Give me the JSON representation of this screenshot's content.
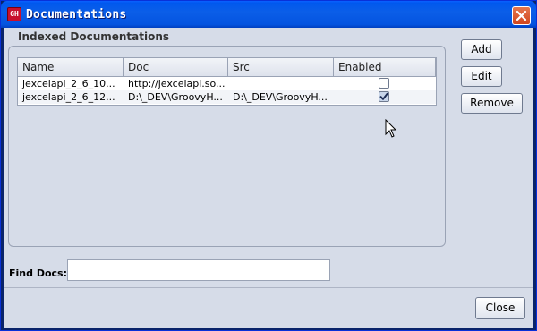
{
  "window": {
    "title": "Documentations",
    "icon_text": "GH"
  },
  "group": {
    "title": "Indexed Documentations"
  },
  "table": {
    "columns": [
      "Name",
      "Doc",
      "Src",
      "Enabled"
    ],
    "rows": [
      {
        "name": "jexcelapi_2_6_10...",
        "doc": "http://jexcelapi.so...",
        "src": "",
        "enabled": false
      },
      {
        "name": "jexcelapi_2_6_12...",
        "doc": "D:\\_DEV\\GroovyH...",
        "src": "D:\\_DEV\\GroovyH...",
        "enabled": true
      }
    ]
  },
  "buttons": {
    "add": "Add",
    "edit": "Edit",
    "remove": "Remove",
    "close": "Close"
  },
  "find": {
    "label": "Find Docs:",
    "value": ""
  }
}
